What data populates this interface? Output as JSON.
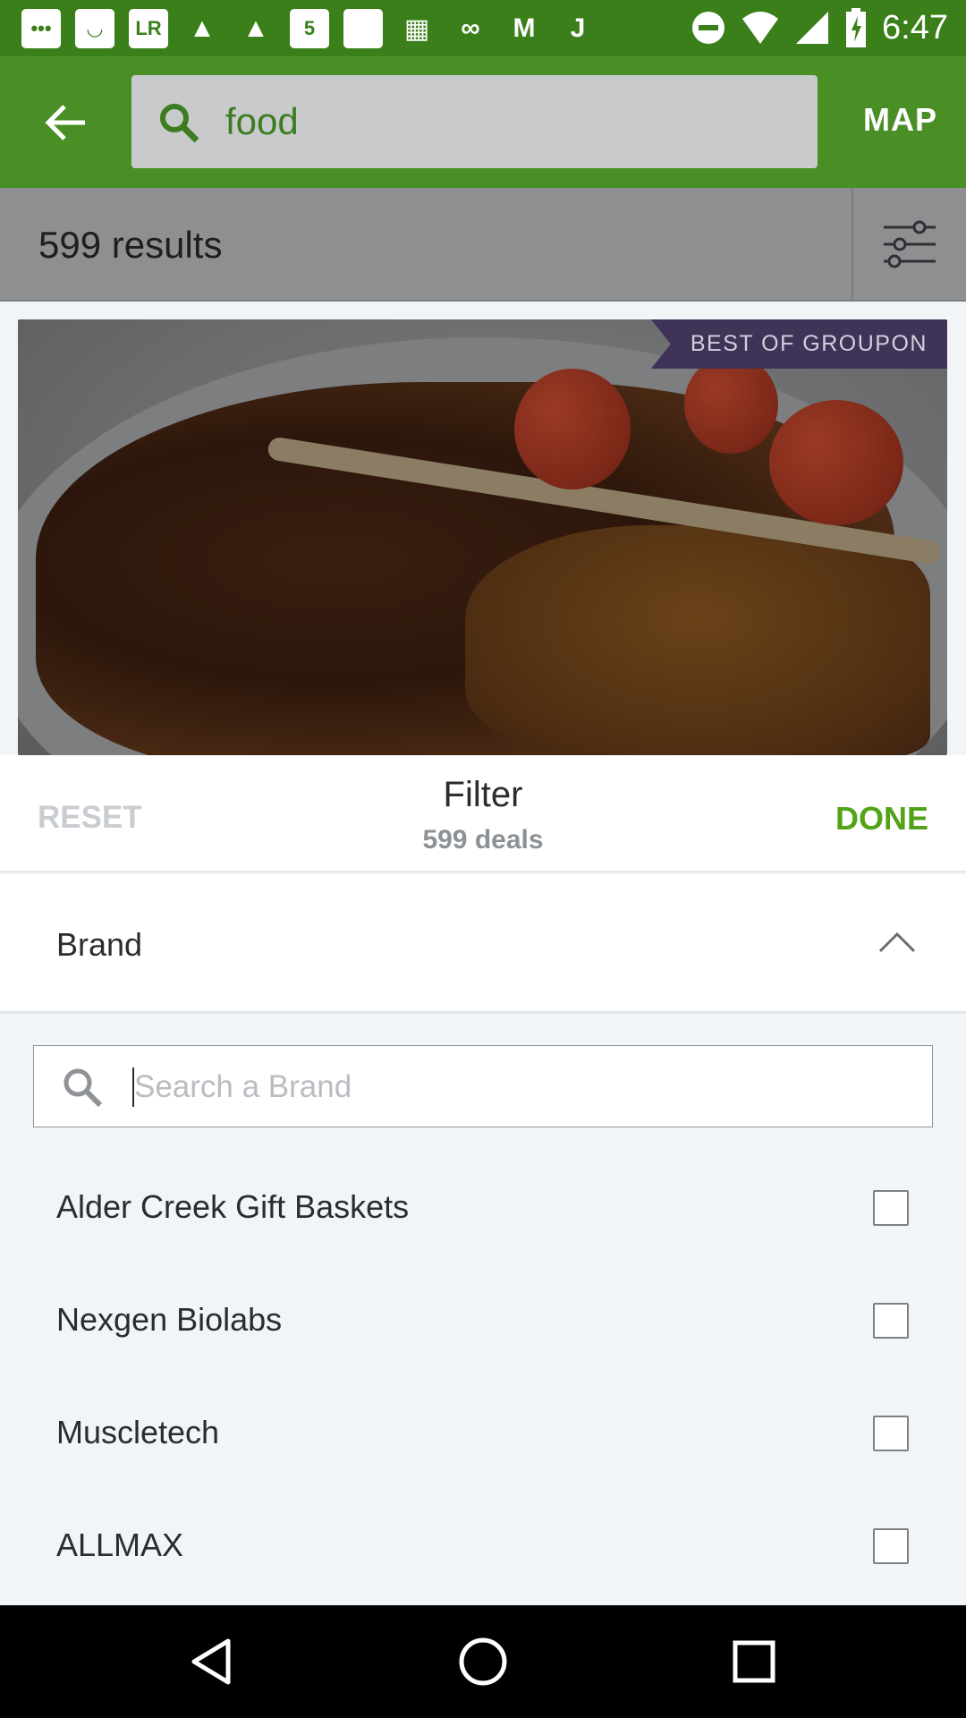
{
  "status_bar": {
    "time": "6:47",
    "left_icons": [
      "message-icon",
      "amazon-icon",
      "lr-icon",
      "shopping-icon",
      "shopping-icon",
      "five-icon",
      "square-icon",
      "grid-icon",
      "link-icon",
      "m-icon",
      "j-icon"
    ],
    "lr_text": "LR",
    "five_text": "5",
    "m_text": "M",
    "j_text": "J",
    "right_icons": [
      "dnd-icon",
      "wifi-icon",
      "signal-icon",
      "battery-icon"
    ]
  },
  "app_bar": {
    "search_query": "food",
    "map_label": "MAP"
  },
  "results": {
    "count_label": "599 results"
  },
  "deal_card": {
    "badge": "BEST OF GROUPON"
  },
  "filter_sheet": {
    "reset_label": "RESET",
    "title": "Filter",
    "subtitle": "599 deals",
    "done_label": "DONE"
  },
  "brand_section": {
    "title": "Brand",
    "search_placeholder": "Search a Brand",
    "items": [
      {
        "label": "Alder Creek Gift Baskets",
        "checked": false
      },
      {
        "label": "Nexgen Biolabs",
        "checked": false
      },
      {
        "label": "Muscletech",
        "checked": false
      },
      {
        "label": "ALLMAX",
        "checked": false
      }
    ]
  },
  "colors": {
    "brand_green": "#53a318",
    "app_bar_dimmed": "#4a8f25",
    "badge_purple": "#3f3457"
  }
}
